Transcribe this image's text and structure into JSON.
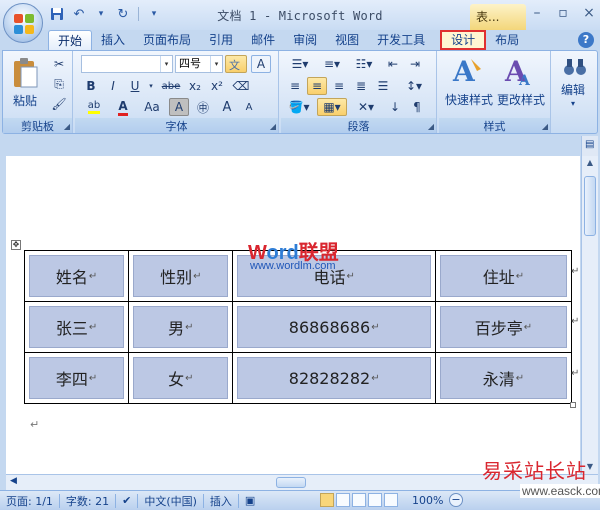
{
  "window": {
    "title": "文档 1 - Microsoft Word",
    "context_tab_header": "表...",
    "controls": [
      "–",
      "▫",
      "×"
    ]
  },
  "quick_access": [
    "save-icon",
    "undo-icon",
    "redo-icon"
  ],
  "tabs": [
    {
      "label": "开始",
      "active": true
    },
    {
      "label": "插入"
    },
    {
      "label": "页面布局"
    },
    {
      "label": "引用"
    },
    {
      "label": "邮件"
    },
    {
      "label": "审阅"
    },
    {
      "label": "视图"
    },
    {
      "label": "开发工具"
    },
    {
      "label": "设计",
      "highlighted": true
    },
    {
      "label": "布局"
    }
  ],
  "ribbon": {
    "clipboard": {
      "label": "剪贴板",
      "paste": "粘贴"
    },
    "font": {
      "label": "字体",
      "font_size": "四号",
      "buttons": [
        "B",
        "I",
        "U",
        "abe",
        "x₂",
        "x²",
        "Aa",
        "A"
      ],
      "grow": "A",
      "shrink": "A"
    },
    "paragraph": {
      "label": "段落"
    },
    "styles": {
      "label": "样式",
      "quick_styles": "快速样式",
      "change_styles": "更改样式"
    },
    "editing": {
      "label": "编辑"
    }
  },
  "watermark": {
    "logo_w": "W",
    "logo_ord": "ord",
    "logo_cn": "联盟",
    "url": "www.wordlm.com"
  },
  "table": {
    "rows": [
      [
        "姓名",
        "性别",
        "电话",
        "住址"
      ],
      [
        "张三",
        "男",
        "86868686",
        "百步亭"
      ],
      [
        "李四",
        "女",
        "82828282",
        "永清"
      ]
    ],
    "cell_mark": "↵"
  },
  "status": {
    "page": "页面: 1/1",
    "words": "字数: 21",
    "language": "中文(中国)",
    "mode": "插入",
    "zoom": "100%"
  },
  "site_watermark": {
    "name": "易采站长站",
    "url": "www.easck.com"
  },
  "colors": {
    "accent": "#15428b",
    "highlight": "#e03030",
    "cell_fill": "#bcc8e4"
  }
}
